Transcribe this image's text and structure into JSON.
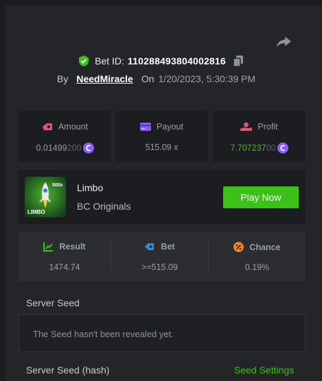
{
  "header": {
    "bet_id_prefix": "Bet ID:",
    "bet_id": "110288493804002816",
    "by_label": "By",
    "username": "NeedMiracle",
    "on_label": "On",
    "datetime": "1/20/2023, 5:30:39 PM"
  },
  "stats": {
    "amount": {
      "label": "Amount",
      "value_main": "0.01499",
      "value_dim": "200"
    },
    "payout": {
      "label": "Payout",
      "value": "515.09 x"
    },
    "profit": {
      "label": "Profit",
      "value_main": "7.707237",
      "value_dim": "00"
    }
  },
  "game": {
    "name": "Limbo",
    "provider": "BC Originals",
    "play_label": "Play Now",
    "thumb_text": "LIMBO",
    "thumb_badge": "500x"
  },
  "result": {
    "result": {
      "label": "Result",
      "value": "1474.74"
    },
    "bet": {
      "label": "Bet",
      "value": ">=515.09"
    },
    "chance": {
      "label": "Chance",
      "value": "0.19%"
    }
  },
  "seed": {
    "server_seed_label": "Server Seed",
    "server_seed_text": "The Seed hasn't been revealed yet.",
    "hash_label": "Server Seed (hash)",
    "settings_label": "Seed Settings"
  },
  "colors": {
    "accent_green": "#3bc117",
    "coin_purple": "#8b5cf6",
    "background": "#232528"
  },
  "icons": {
    "share": "share-icon",
    "verified": "shield-check-icon",
    "copy": "copy-icon",
    "amount": "amount-icon",
    "payout": "payout-card-icon",
    "profit": "profit-icon",
    "result": "result-chart-icon",
    "bet": "bet-icon",
    "chance": "chance-percent-icon",
    "coin": "coin-icon"
  }
}
